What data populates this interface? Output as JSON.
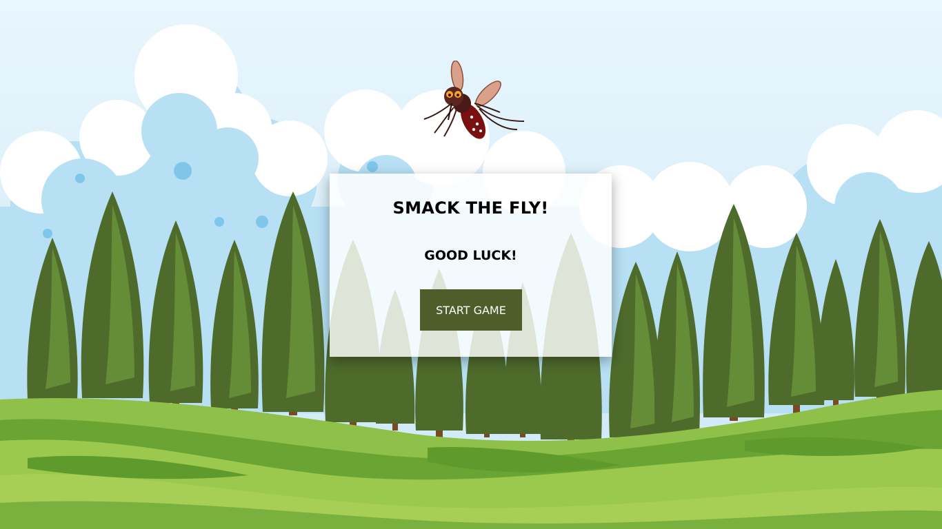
{
  "game": {
    "title": "SMACK THE FLY!",
    "subtitle": "GOOD LUCK!",
    "start_label": "START GAME"
  },
  "colors": {
    "sky": "#d8eef9",
    "cloud": "#ffffff",
    "cloud_blue": "#b7e0f4",
    "tree_dark": "#4e6b2c",
    "tree_light": "#a7c95a",
    "grass_light": "#9bc94d",
    "grass_dark": "#4f8a25",
    "button": "#4d5e2b"
  }
}
